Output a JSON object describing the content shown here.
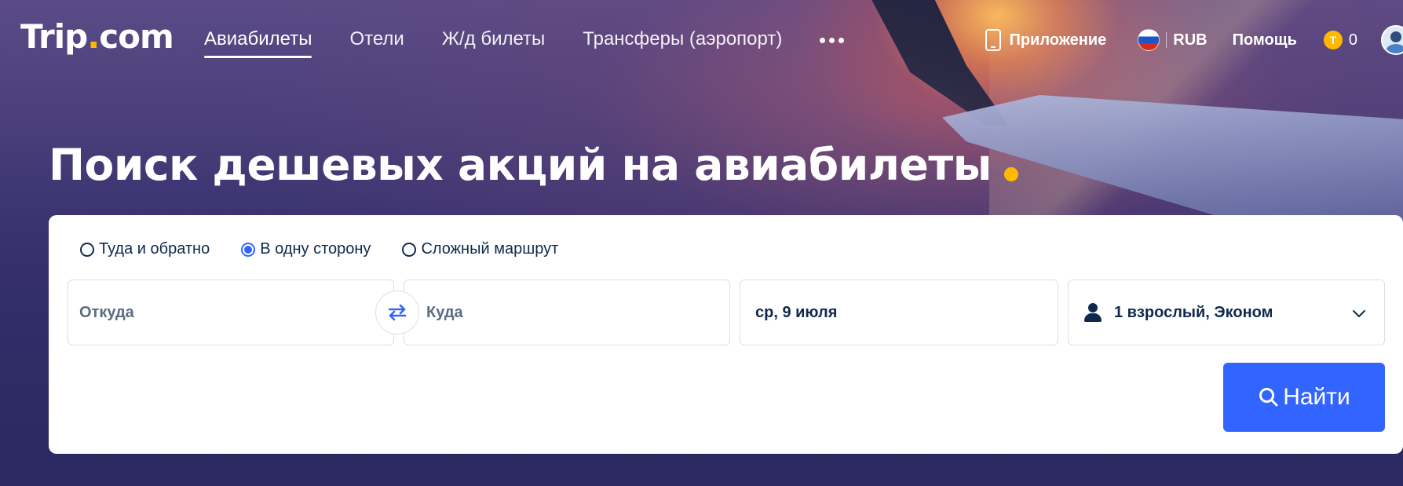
{
  "brand": {
    "logo_text_a": "Trip",
    "logo_dot": ".",
    "logo_text_b": "com"
  },
  "nav": {
    "items": [
      {
        "label": "Авиабилеты",
        "active": true
      },
      {
        "label": "Отели"
      },
      {
        "label": "Ж/д билеты"
      },
      {
        "label": "Трансферы (аэропорт)"
      }
    ],
    "more_icon": "more-dots-icon"
  },
  "header_right": {
    "app_label": "Приложение",
    "currency_label": "RUB",
    "help_label": "Помощь",
    "coins_value": "0",
    "coin_glyph": "T"
  },
  "hero": {
    "title": "Поиск дешевых акций на авиабилеты"
  },
  "search": {
    "trip_types": [
      {
        "label": "Туда и обратно",
        "checked": false
      },
      {
        "label": "В одну сторону",
        "checked": true
      },
      {
        "label": "Сложный маршрут",
        "checked": false
      }
    ],
    "from_placeholder": "Откуда",
    "to_placeholder": "Куда",
    "date_value": "ср, 9 июля",
    "passengers_value": "1 взрослый, Эконом",
    "search_label": "Найти"
  },
  "colors": {
    "accent": "#3264ff",
    "brand_yellow": "#ffb900",
    "text_dark": "#0f294d"
  }
}
